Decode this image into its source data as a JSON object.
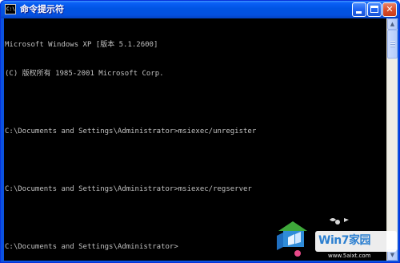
{
  "window": {
    "title": "命令提示符",
    "icon_label": "C:\\",
    "controls": {
      "minimize": "minimize",
      "maximize": "maximize",
      "close": "✕"
    }
  },
  "console": {
    "lines": [
      "Microsoft Windows XP [版本 5.1.2600]",
      "(C) 版权所有 1985-2001 Microsoft Corp.",
      "",
      "C:\\Documents and Settings\\Administrator>msiexec/unregister",
      "",
      "C:\\Documents and Settings\\Administrator>msiexec/regserver",
      "",
      "C:\\Documents and Settings\\Administrator>"
    ],
    "colors": {
      "background": "#000000",
      "text": "#c0c0c0"
    }
  },
  "scrollbar": {
    "up_icon": "scroll-up-arrow-icon",
    "down_icon": "scroll-down-arrow-icon"
  },
  "watermark": {
    "brand": "Win7家园",
    "url": "www.5aixt.com"
  }
}
